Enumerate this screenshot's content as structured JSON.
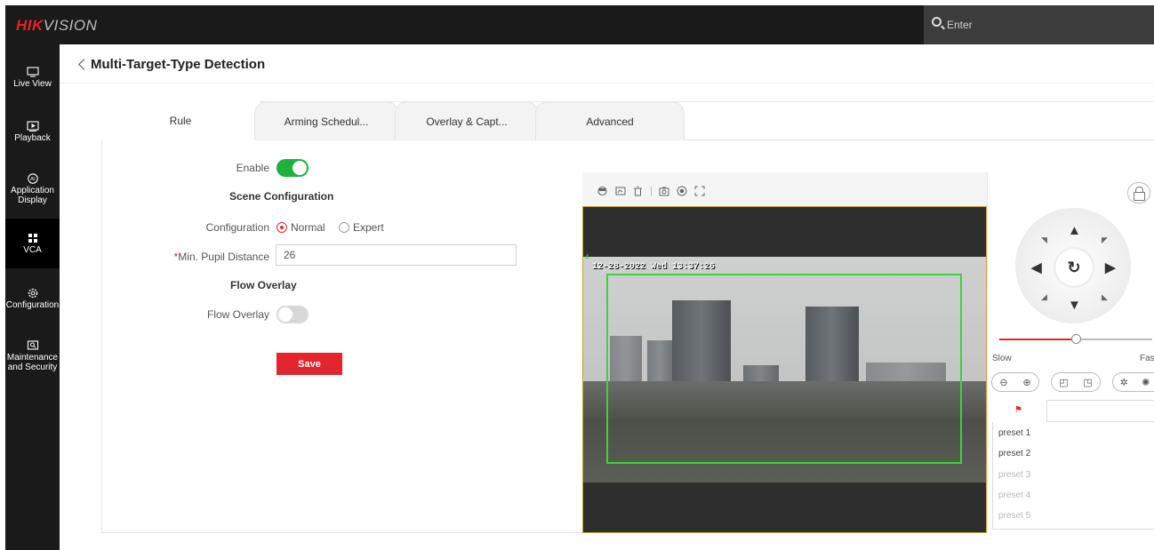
{
  "brand": {
    "logo_red": "HIK",
    "logo_grey": "VISION"
  },
  "search": {
    "placeholder": "Enter",
    "icon": "search-icon"
  },
  "sidebar": {
    "items": [
      {
        "label": "Live View",
        "icon": "monitor-icon"
      },
      {
        "label": "Playback",
        "icon": "play-icon"
      },
      {
        "label": "Application Display",
        "icon": "ai-icon"
      },
      {
        "label": "VCA",
        "icon": "grid-icon",
        "active": true
      },
      {
        "label": "Configuration",
        "icon": "gear-icon"
      },
      {
        "label": "Maintenance and Security",
        "icon": "maintenance-icon"
      }
    ]
  },
  "page": {
    "title": "Multi-Target-Type Detection"
  },
  "tabs": [
    {
      "label": "Rule",
      "active": true
    },
    {
      "label": "Arming Schedul..."
    },
    {
      "label": "Overlay & Capt..."
    },
    {
      "label": "Advanced"
    }
  ],
  "form": {
    "enable_label": "Enable",
    "enable_on": true,
    "scene_title": "Scene Configuration",
    "configuration_label": "Configuration",
    "radio_normal": "Normal",
    "radio_expert": "Expert",
    "radio_selected": "Normal",
    "required_mark": "*",
    "min_pupil_label": "Min. Pupil Distance",
    "min_pupil_value": "26",
    "flow_overlay_title": "Flow Overlay",
    "flow_overlay_label": "Flow Overlay",
    "flow_overlay_on": false,
    "save_label": "Save"
  },
  "video": {
    "osd_text": "12-28-2022 Wed 13:37:26",
    "roi_corner": "4",
    "toolbar_icons": [
      "target-icon",
      "draw-area-icon",
      "delete-icon",
      "capture-icon",
      "record-icon",
      "fullscreen-icon"
    ]
  },
  "ptz": {
    "speed_slow": "Slow",
    "speed_fast": "Fas",
    "speed_level": 0.5,
    "presets": [
      {
        "label": "preset 1",
        "configured": true
      },
      {
        "label": "preset 2",
        "configured": true
      },
      {
        "label": "preset 3",
        "configured": false
      },
      {
        "label": "preset 4",
        "configured": false
      },
      {
        "label": "preset 5",
        "configured": false
      }
    ]
  },
  "colors": {
    "accent_red": "#e3262d",
    "toggle_green": "#1fb140",
    "roi_green": "#2fdc2f"
  }
}
